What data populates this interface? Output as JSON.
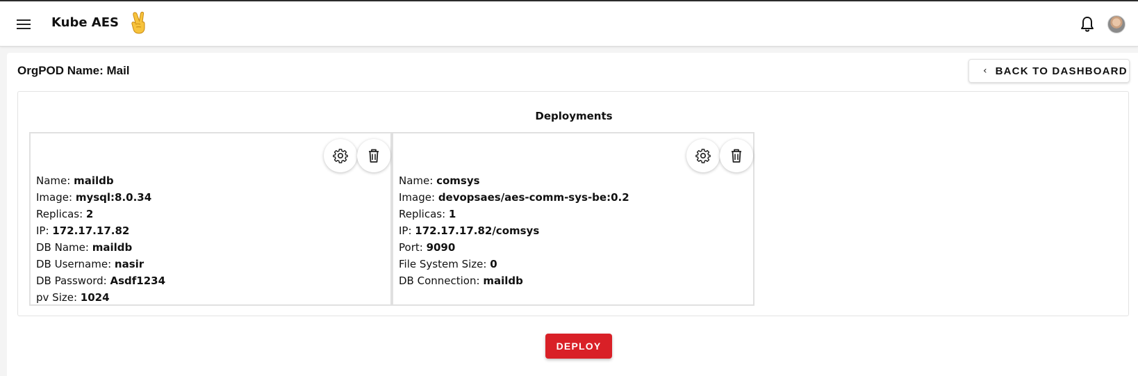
{
  "header": {
    "app_title": "Kube AES",
    "logo_icon": "victory-hand-icon",
    "menu_icon": "hamburger-menu-icon",
    "bell_icon": "bell-icon",
    "avatar_icon": "user-avatar"
  },
  "page": {
    "title": "OrgPOD Name: Mail",
    "back_button_label": "BACK TO DASHBOARD"
  },
  "deployments": {
    "title": "Deployments",
    "cards": [
      {
        "fields": [
          {
            "label": "Name: ",
            "value": "maildb"
          },
          {
            "label": "Image: ",
            "value": "mysql:8.0.34"
          },
          {
            "label": "Replicas: ",
            "value": "2"
          },
          {
            "label": "IP: ",
            "value": "172.17.17.82"
          },
          {
            "label": "DB Name: ",
            "value": "maildb"
          },
          {
            "label": "DB Username: ",
            "value": "nasir"
          },
          {
            "label": "DB Password: ",
            "value": "Asdf1234"
          },
          {
            "label": "pv Size: ",
            "value": "1024"
          }
        ]
      },
      {
        "fields": [
          {
            "label": "Name: ",
            "value": "comsys"
          },
          {
            "label": "Image: ",
            "value": "devopsaes/aes-comm-sys-be:0.2"
          },
          {
            "label": "Replicas: ",
            "value": "1"
          },
          {
            "label": "IP: ",
            "value": "172.17.17.82/comsys"
          },
          {
            "label": "Port: ",
            "value": "9090"
          },
          {
            "label": "File System Size: ",
            "value": "0"
          },
          {
            "label": "DB Connection: ",
            "value": "maildb"
          }
        ]
      }
    ]
  },
  "actions": {
    "deploy_label": "DEPLOY"
  },
  "colors": {
    "deploy_button": "#d92027",
    "background": "#f4f4f4",
    "card_border": "#e0e0e0"
  }
}
